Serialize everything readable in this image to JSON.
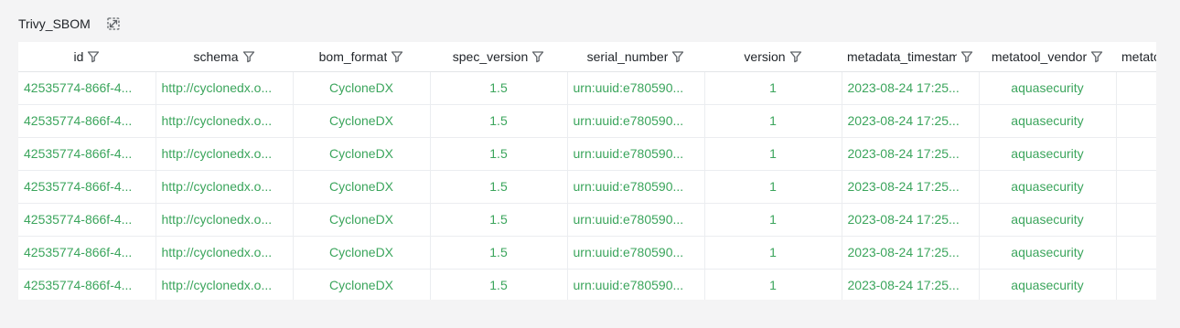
{
  "panel": {
    "title": "Trivy_SBOM"
  },
  "table": {
    "columns": [
      "id",
      "schema",
      "bom_format",
      "spec_version",
      "serial_number",
      "version",
      "metadata_timestamp",
      "metatool_vendor",
      "metatool_name"
    ],
    "rows": [
      [
        "42535774-866f-4...",
        "http://cyclonedx.o...",
        "CycloneDX",
        "1.5",
        "urn:uuid:e780590...",
        "1",
        "2023-08-24 17:25...",
        "aquasecurity",
        ""
      ],
      [
        "42535774-866f-4...",
        "http://cyclonedx.o...",
        "CycloneDX",
        "1.5",
        "urn:uuid:e780590...",
        "1",
        "2023-08-24 17:25...",
        "aquasecurity",
        ""
      ],
      [
        "42535774-866f-4...",
        "http://cyclonedx.o...",
        "CycloneDX",
        "1.5",
        "urn:uuid:e780590...",
        "1",
        "2023-08-24 17:25...",
        "aquasecurity",
        ""
      ],
      [
        "42535774-866f-4...",
        "http://cyclonedx.o...",
        "CycloneDX",
        "1.5",
        "urn:uuid:e780590...",
        "1",
        "2023-08-24 17:25...",
        "aquasecurity",
        ""
      ],
      [
        "42535774-866f-4...",
        "http://cyclonedx.o...",
        "CycloneDX",
        "1.5",
        "urn:uuid:e780590...",
        "1",
        "2023-08-24 17:25...",
        "aquasecurity",
        ""
      ],
      [
        "42535774-866f-4...",
        "http://cyclonedx.o...",
        "CycloneDX",
        "1.5",
        "urn:uuid:e780590...",
        "1",
        "2023-08-24 17:25...",
        "aquasecurity",
        ""
      ],
      [
        "42535774-866f-4...",
        "http://cyclonedx.o...",
        "CycloneDX",
        "1.5",
        "urn:uuid:e780590...",
        "1",
        "2023-08-24 17:25...",
        "aquasecurity",
        ""
      ]
    ]
  },
  "icons": {
    "filter": "filter-icon",
    "expand": "expand-icon"
  },
  "colors": {
    "cell_text": "#3ba55c",
    "header_text": "#1f2328",
    "background": "#f4f4f5"
  }
}
